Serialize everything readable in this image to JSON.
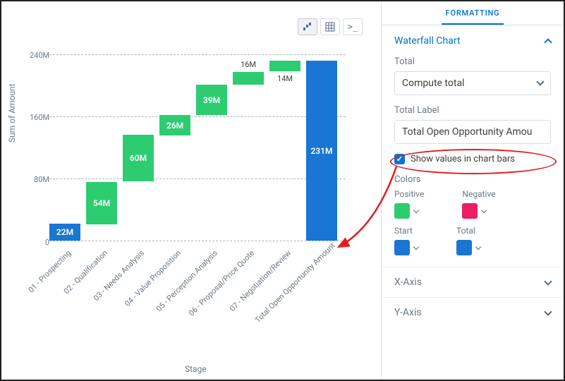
{
  "tabs": {
    "formatting": "FORMATTING"
  },
  "section": {
    "waterfall": "Waterfall Chart",
    "total_label": "Total",
    "total_value": "Compute total",
    "total_label_label": "Total Label",
    "total_label_value": "Total Open Opportunity Amou",
    "show_values": "Show values in chart bars",
    "colors_label": "Colors",
    "positive": "Positive",
    "negative": "Negative",
    "start": "Start",
    "total": "Total",
    "x_axis": "X-Axis",
    "y_axis": "Y-Axis"
  },
  "colors": {
    "positive": "#2ecc71",
    "negative": "#e91e63",
    "start": "#1976d2",
    "total": "#1976d2"
  },
  "chart_data": {
    "type": "waterfall",
    "xlabel": "Stage",
    "ylabel": "Sum of Amount",
    "ylim": [
      0,
      240
    ],
    "y_ticks": [
      "240M",
      "160M",
      "80M",
      "0"
    ],
    "categories": [
      "01 - Prospecting",
      "02 - Qualification",
      "03 - Needs Analysis",
      "04 - Value Proposition",
      "05 - Perception Analysis",
      "06 - Proposal/Price Quote",
      "07 - Negotiation/Review",
      "Total Open Opportunity Amount"
    ],
    "values": [
      22,
      54,
      60,
      26,
      39,
      16,
      14,
      231
    ],
    "display_labels": [
      "22M",
      "54M",
      "60M",
      "26M",
      "39M",
      "16M",
      "14M",
      "231M"
    ],
    "bar_types": [
      "start",
      "pos",
      "pos",
      "pos",
      "pos",
      "pos",
      "pos",
      "total"
    ]
  }
}
